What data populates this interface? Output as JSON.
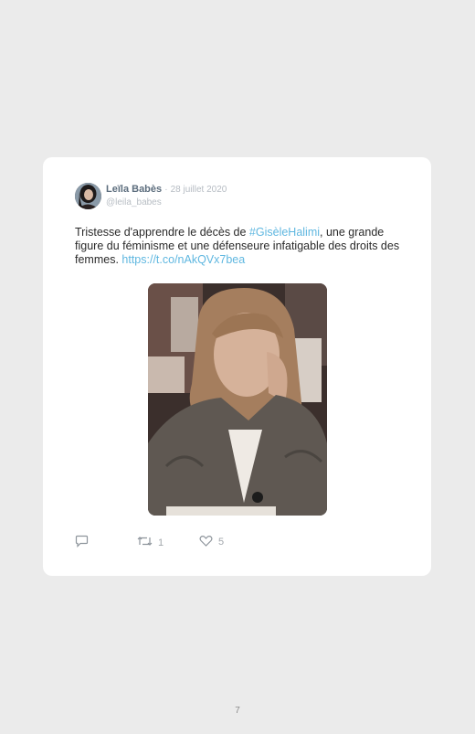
{
  "tweet": {
    "author_name": "Leïla Babès",
    "separator": "·",
    "date": "28 juillet 2020",
    "handle": "@leila_babes",
    "text_before": "Tristesse d'apprendre le décès de ",
    "hashtag": "#GisèleHalimi",
    "text_after": ", une grande figure du féminisme et une défenseure infatigable des droits des femmes. ",
    "link": "https://t.co/nAkQVx7bea",
    "retweet_count": "1",
    "like_count": "5"
  },
  "icons": {
    "reply": "speech-bubble-icon",
    "retweet": "retweet-icon",
    "like": "heart-icon"
  },
  "page": {
    "number": "7"
  },
  "colors": {
    "background": "#ebebeb",
    "card": "#ffffff",
    "link": "#5fb7e0",
    "author": "#5d6e7e",
    "muted": "#a3a8ad"
  }
}
